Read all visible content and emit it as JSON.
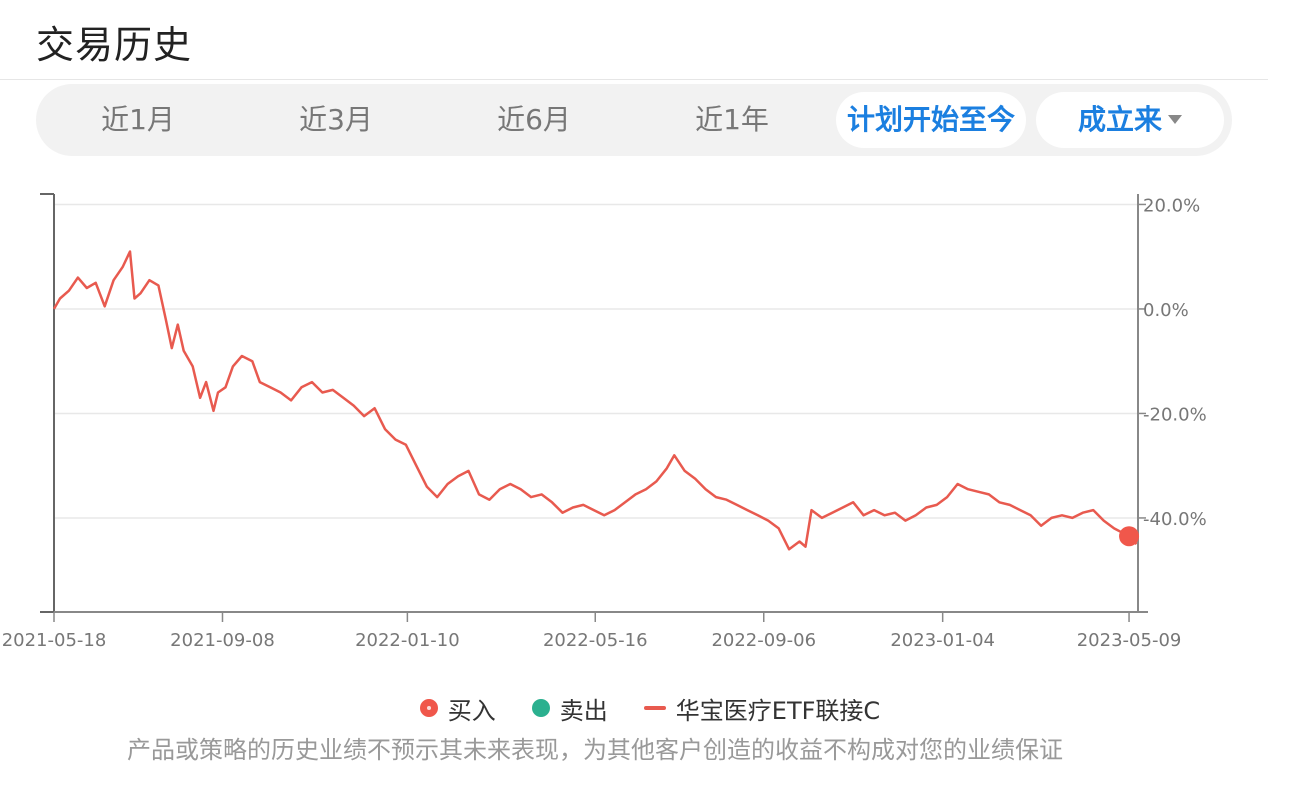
{
  "page": {
    "title": "交易历史"
  },
  "tabs": [
    {
      "label": "近1月",
      "active": false
    },
    {
      "label": "近3月",
      "active": false
    },
    {
      "label": "近6月",
      "active": false
    },
    {
      "label": "近1年",
      "active": false
    },
    {
      "label": "计划开始至今",
      "active": true
    },
    {
      "label": "成立来",
      "active": true
    }
  ],
  "legend": {
    "buy": "买入",
    "sell": "卖出",
    "series": "华宝医疗ETF联接C"
  },
  "disclaimer": "产品或策略的历史业绩不预示其未来表现，为其他客户创造的收益不构成对您的业绩保证",
  "colors": {
    "accent": "#1b7fe0",
    "line": "#e85a4f",
    "buy": "#f0574b",
    "sell": "#2bb08f"
  },
  "chart_data": {
    "type": "line",
    "title": "",
    "xlabel": "",
    "ylabel": "",
    "x_ticks": [
      "2021-05-18",
      "2021-09-08",
      "2022-01-10",
      "2022-05-16",
      "2022-09-06",
      "2023-01-04",
      "2023-05-09"
    ],
    "y_ticks": [
      "20.0%",
      "0.0%",
      "-20.0%",
      "-40.0%"
    ],
    "ylim": [
      -58,
      22
    ],
    "xlim": [
      "2021-05-18",
      "2023-05-15"
    ],
    "grid": true,
    "series": [
      {
        "name": "华宝医疗ETF联接C",
        "points": [
          [
            "2021-05-18",
            0.0
          ],
          [
            "2021-05-22",
            2.0
          ],
          [
            "2021-05-28",
            3.5
          ],
          [
            "2021-06-03",
            6.0
          ],
          [
            "2021-06-09",
            4.0
          ],
          [
            "2021-06-15",
            5.0
          ],
          [
            "2021-06-21",
            0.5
          ],
          [
            "2021-06-27",
            5.5
          ],
          [
            "2021-07-03",
            8.0
          ],
          [
            "2021-07-08",
            11.0
          ],
          [
            "2021-07-11",
            2.0
          ],
          [
            "2021-07-15",
            3.0
          ],
          [
            "2021-07-21",
            5.5
          ],
          [
            "2021-07-27",
            4.5
          ],
          [
            "2021-08-01",
            -2.0
          ],
          [
            "2021-08-05",
            -7.5
          ],
          [
            "2021-08-09",
            -3.0
          ],
          [
            "2021-08-13",
            -8.0
          ],
          [
            "2021-08-19",
            -11.0
          ],
          [
            "2021-08-24",
            -17.0
          ],
          [
            "2021-08-28",
            -14.0
          ],
          [
            "2021-09-02",
            -19.5
          ],
          [
            "2021-09-05",
            -16.0
          ],
          [
            "2021-09-10",
            -15.0
          ],
          [
            "2021-09-15",
            -11.0
          ],
          [
            "2021-09-21",
            -9.0
          ],
          [
            "2021-09-28",
            -10.0
          ],
          [
            "2021-10-03",
            -14.0
          ],
          [
            "2021-10-10",
            -15.0
          ],
          [
            "2021-10-17",
            -16.0
          ],
          [
            "2021-10-24",
            -17.5
          ],
          [
            "2021-10-31",
            -15.0
          ],
          [
            "2021-11-07",
            -14.0
          ],
          [
            "2021-11-14",
            -16.0
          ],
          [
            "2021-11-21",
            -15.5
          ],
          [
            "2021-11-28",
            -17.0
          ],
          [
            "2021-12-05",
            -18.5
          ],
          [
            "2021-12-12",
            -20.5
          ],
          [
            "2021-12-19",
            -19.0
          ],
          [
            "2021-12-26",
            -23.0
          ],
          [
            "2022-01-02",
            -25.0
          ],
          [
            "2022-01-09",
            -26.0
          ],
          [
            "2022-01-16",
            -30.0
          ],
          [
            "2022-01-23",
            -34.0
          ],
          [
            "2022-01-30",
            -36.0
          ],
          [
            "2022-02-06",
            -33.5
          ],
          [
            "2022-02-13",
            -32.0
          ],
          [
            "2022-02-20",
            -31.0
          ],
          [
            "2022-02-27",
            -35.5
          ],
          [
            "2022-03-06",
            -36.5
          ],
          [
            "2022-03-13",
            -34.5
          ],
          [
            "2022-03-20",
            -33.5
          ],
          [
            "2022-03-27",
            -34.5
          ],
          [
            "2022-04-03",
            -36.0
          ],
          [
            "2022-04-10",
            -35.5
          ],
          [
            "2022-04-17",
            -37.0
          ],
          [
            "2022-04-24",
            -39.0
          ],
          [
            "2022-05-01",
            -38.0
          ],
          [
            "2022-05-08",
            -37.5
          ],
          [
            "2022-05-15",
            -38.5
          ],
          [
            "2022-05-22",
            -39.5
          ],
          [
            "2022-05-29",
            -38.5
          ],
          [
            "2022-06-05",
            -37.0
          ],
          [
            "2022-06-12",
            -35.5
          ],
          [
            "2022-06-19",
            -34.5
          ],
          [
            "2022-06-26",
            -33.0
          ],
          [
            "2022-07-03",
            -30.5
          ],
          [
            "2022-07-08",
            -28.0
          ],
          [
            "2022-07-15",
            -31.0
          ],
          [
            "2022-07-22",
            -32.5
          ],
          [
            "2022-07-29",
            -34.5
          ],
          [
            "2022-08-05",
            -36.0
          ],
          [
            "2022-08-12",
            -36.5
          ],
          [
            "2022-08-19",
            -37.5
          ],
          [
            "2022-08-26",
            -38.5
          ],
          [
            "2022-09-02",
            -39.5
          ],
          [
            "2022-09-09",
            -40.5
          ],
          [
            "2022-09-16",
            -42.0
          ],
          [
            "2022-09-23",
            -46.0
          ],
          [
            "2022-09-30",
            -44.5
          ],
          [
            "2022-10-04",
            -45.5
          ],
          [
            "2022-10-08",
            -38.5
          ],
          [
            "2022-10-15",
            -40.0
          ],
          [
            "2022-10-22",
            -39.0
          ],
          [
            "2022-10-29",
            -38.0
          ],
          [
            "2022-11-05",
            -37.0
          ],
          [
            "2022-11-12",
            -39.5
          ],
          [
            "2022-11-19",
            -38.5
          ],
          [
            "2022-11-26",
            -39.5
          ],
          [
            "2022-12-03",
            -39.0
          ],
          [
            "2022-12-10",
            -40.5
          ],
          [
            "2022-12-17",
            -39.5
          ],
          [
            "2022-12-24",
            -38.0
          ],
          [
            "2022-12-31",
            -37.5
          ],
          [
            "2023-01-07",
            -36.0
          ],
          [
            "2023-01-14",
            -33.5
          ],
          [
            "2023-01-21",
            -34.5
          ],
          [
            "2023-01-28",
            -35.0
          ],
          [
            "2023-02-04",
            -35.5
          ],
          [
            "2023-02-11",
            -37.0
          ],
          [
            "2023-02-18",
            -37.5
          ],
          [
            "2023-02-25",
            -38.5
          ],
          [
            "2023-03-04",
            -39.5
          ],
          [
            "2023-03-11",
            -41.5
          ],
          [
            "2023-03-18",
            -40.0
          ],
          [
            "2023-03-25",
            -39.5
          ],
          [
            "2023-04-01",
            -40.0
          ],
          [
            "2023-04-08",
            -39.0
          ],
          [
            "2023-04-15",
            -38.5
          ],
          [
            "2023-04-22",
            -40.5
          ],
          [
            "2023-04-29",
            -42.0
          ],
          [
            "2023-05-09",
            -43.5
          ],
          [
            "2023-05-14",
            -45.0
          ]
        ]
      }
    ],
    "buy_points": [
      [
        "2023-05-09",
        -43.5
      ]
    ],
    "sell_points": []
  }
}
